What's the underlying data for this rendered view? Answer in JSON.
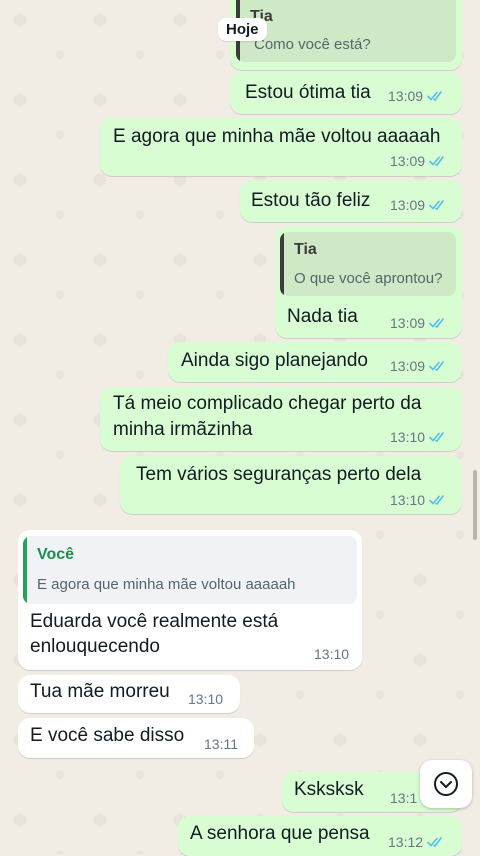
{
  "date_chip": "Hoje",
  "messages": [
    {
      "quote_name": "Tia",
      "quote_text": "Como você está?"
    },
    {
      "text": "Estou ótima tia",
      "time": "13:09"
    },
    {
      "text": "E agora que minha mãe voltou aaaaah",
      "time": "13:09"
    },
    {
      "text": "Estou tão feliz",
      "time": "13:09"
    },
    {
      "quote_name": "Tia",
      "quote_text": "O que você aprontou?",
      "text": "Nada tia",
      "time": "13:09"
    },
    {
      "text": "Ainda sigo planejando",
      "time": "13:09"
    },
    {
      "text_line1": "Tá meio complicado chegar perto da",
      "text_line2": "minha irmãzinha",
      "time": "13:10"
    },
    {
      "text": "Tem vários seguranças perto dela",
      "time": "13:10"
    },
    {
      "quote_name": "Você",
      "quote_text": "E agora que minha mãe voltou aaaaah",
      "text_line1": "Eduarda você realmente está",
      "text_line2": "enlouquecendo",
      "time": "13:10"
    },
    {
      "text": "Tua mãe morreu",
      "time": "13:10"
    },
    {
      "text": "E você sabe disso",
      "time": "13:11"
    },
    {
      "text": "Ksksksk",
      "time": "13:1"
    },
    {
      "text": "A senhora que pensa",
      "time": "13:12"
    }
  ],
  "colors": {
    "outgoing_bubble": "#d9fdd3",
    "incoming_bubble": "#ffffff",
    "read_ticks": "#53bdeb",
    "quote_bar_tia": "#3b3b3b",
    "quote_bar_voce": "#25a35a",
    "quote_name_voce": "#1d8f4c"
  },
  "icons": {
    "read_receipt": "double-check-icon",
    "scroll_down": "chevron-down-icon"
  }
}
